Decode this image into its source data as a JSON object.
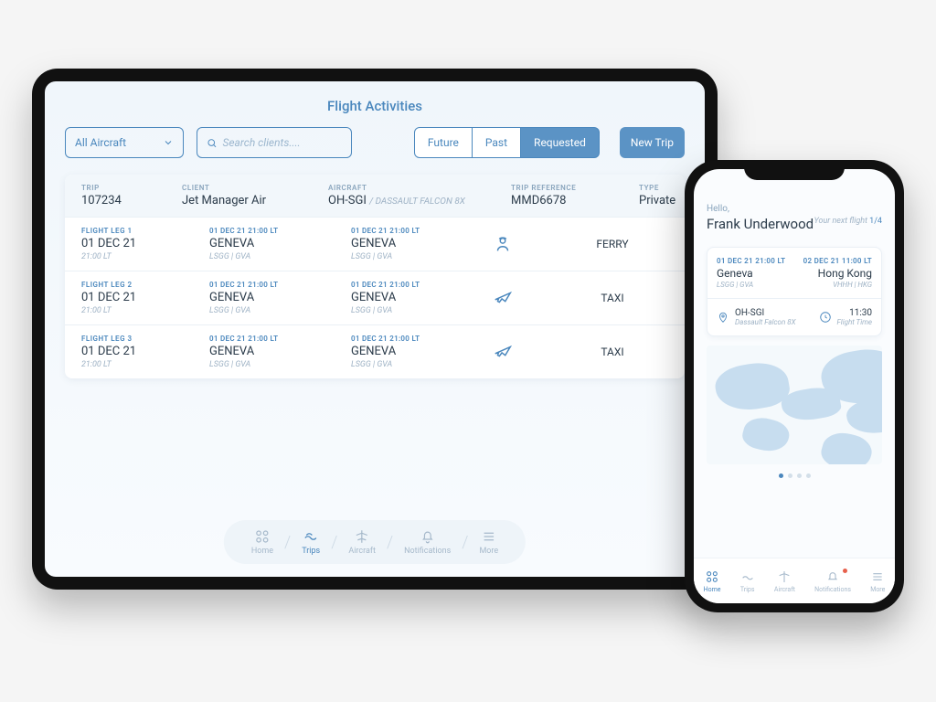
{
  "tablet": {
    "title": "Flight Activities",
    "aircraft_filter": "All Aircraft",
    "search_placeholder": "Search clients....",
    "segments": {
      "future": "Future",
      "past": "Past",
      "requested": "Requested"
    },
    "new_trip": "New Trip",
    "header": {
      "trip_lbl": "TRIP",
      "trip_val": "107234",
      "client_lbl": "CLIENT",
      "client_val": "Jet Manager Air",
      "aircraft_lbl": "AIRCRAFT",
      "aircraft_val": "OH-SGI",
      "aircraft_sub": "/ DASSAULT FALCON 8X",
      "ref_lbl": "TRIP REFERENCE",
      "ref_val": "MMD6678",
      "type_lbl": "TYPE",
      "type_val": "Private"
    },
    "legs": [
      {
        "lbl": "FLIGHT LEG 1",
        "date": "01 DEC 21",
        "time": "21:00 LT",
        "dep_dt": "01 DEC 21 21:00 LT",
        "dep_city": "GENEVA",
        "dep_code": "LSGG | GVA",
        "arr_dt": "01 DEC 21 21:00 LT",
        "arr_city": "GENEVA",
        "arr_code": "LSGG | GVA",
        "type": "FERRY",
        "icon": "pilot"
      },
      {
        "lbl": "FLIGHT LEG 2",
        "date": "01 DEC 21",
        "time": "21:00 LT",
        "dep_dt": "01 DEC 21 21:00 LT",
        "dep_city": "GENEVA",
        "dep_code": "LSGG | GVA",
        "arr_dt": "01 DEC 21 21:00 LT",
        "arr_city": "GENEVA",
        "arr_code": "LSGG | GVA",
        "type": "TAXI",
        "icon": "plane"
      },
      {
        "lbl": "FLIGHT LEG 3",
        "date": "01 DEC 21",
        "time": "21:00 LT",
        "dep_dt": "01 DEC 21 21:00 LT",
        "dep_city": "GENEVA",
        "dep_code": "LSGG | GVA",
        "arr_dt": "01 DEC 21 21:00 LT",
        "arr_city": "GENEVA",
        "arr_code": "LSGG | GVA",
        "type": "TAXI",
        "icon": "plane"
      }
    ],
    "nav": {
      "home": "Home",
      "trips": "Trips",
      "aircraft": "Aircraft",
      "notifications": "Notifications",
      "more": "More"
    }
  },
  "phone": {
    "greeting": "Hello,",
    "user": "Frank Underwood",
    "next_label": "Your next flight ",
    "next_count": "1/4",
    "card": {
      "dep_dt": "01 DEC 21 21:00 LT",
      "dep_city": "Geneva",
      "dep_code": "LSGG | GVA",
      "arr_dt": "02 DEC 21 11:00 LT",
      "arr_city": "Hong Kong",
      "arr_code": "VHHH | HKG",
      "aircraft": "OH-SGI",
      "aircraft_model": "Dassault Falcon 8X",
      "flight_time_val": "11:30",
      "flight_time_lbl": "Flight Time"
    },
    "nav": {
      "home": "Home",
      "trips": "Trips",
      "aircraft": "Aircraft",
      "notifications": "Notifications",
      "more": "More"
    }
  }
}
